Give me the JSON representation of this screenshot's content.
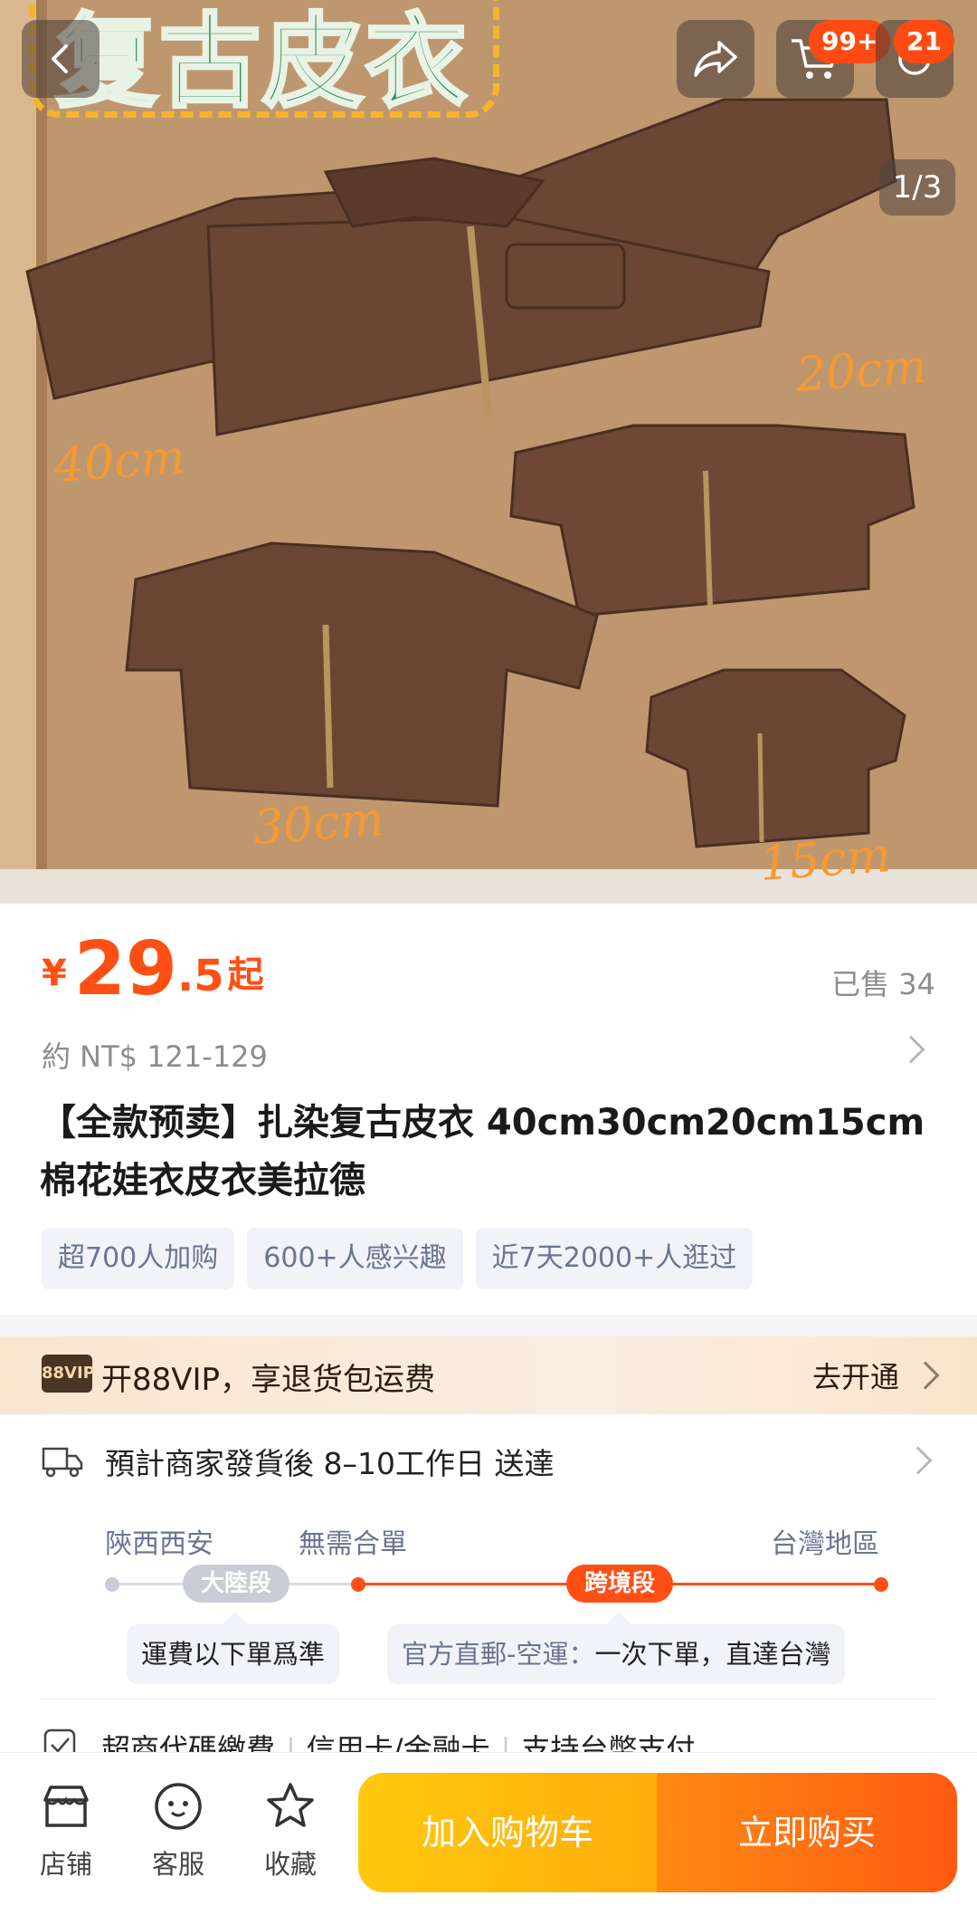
{
  "hero": {
    "title_text": "复古皮衣",
    "size_labels": [
      "40cm",
      "20cm",
      "30cm",
      "15cm"
    ],
    "page_indicator": "1/3",
    "cart_badge": "99+",
    "msg_badge": "21"
  },
  "price": {
    "currency": "¥",
    "integer": "29",
    "decimal": ".5",
    "suffix": "起",
    "sold": "已售 34",
    "converted": "約 NT$ 121-129"
  },
  "product": {
    "title": "【全款预卖】扎染复古皮衣 40cm30cm20cm15cm棉花娃衣皮衣美拉德",
    "tags": [
      "超700人加购",
      "600+人感兴趣",
      "近7天2000+人逛过"
    ]
  },
  "vip": {
    "logo": "88VIP",
    "text": "开88VIP，享退货包运费",
    "action": "去开通"
  },
  "shipping": {
    "text": "預計商家發貨後 8–10工作日 送達",
    "origin": "陝西西安",
    "merge": "無需合單",
    "destination": "台灣地區",
    "segment1": "大陸段",
    "segment2": "跨境段",
    "note1": "運費以下單爲準",
    "note2_grey": "官方直郵-空運：",
    "note2": "一次下單，直達台灣"
  },
  "payment": {
    "items": [
      "超商代碼繳費",
      "信用卡/金融卡",
      "支持台幣支付"
    ]
  },
  "bottom_bar": {
    "store": "店铺",
    "service": "客服",
    "favorite": "收藏",
    "add_cart": "加入购物车",
    "buy_now": "立即购买"
  },
  "colors": {
    "accent": "#ff4f14",
    "cart_btn": "#ffb80c",
    "buy_btn": "#ff6a12",
    "tag_text": "#6b7590"
  }
}
